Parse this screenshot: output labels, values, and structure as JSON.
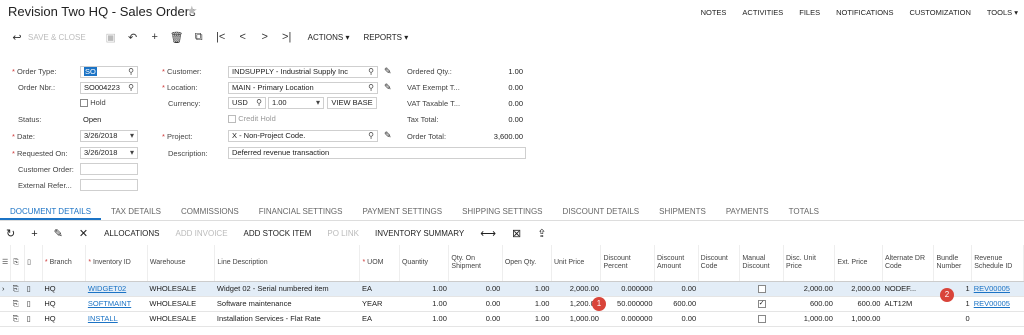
{
  "header": {
    "title": "Revision Two HQ  -  Sales Orders",
    "nav": [
      "NOTES",
      "ACTIVITIES",
      "FILES",
      "NOTIFICATIONS",
      "CUSTOMIZATION",
      "TOOLS ▾"
    ]
  },
  "toolbar": {
    "save_close": "SAVE & CLOSE",
    "actions": "ACTIONS ▾",
    "reports": "REPORTS ▾"
  },
  "form": {
    "order_type_label": "Order Type:",
    "order_type": "SO",
    "order_nbr_label": "Order Nbr.:",
    "order_nbr": "SO004223",
    "hold_label": "Hold",
    "status_label": "Status:",
    "status": "Open",
    "date_label": "Date:",
    "date": "3/26/2018",
    "requested_on_label": "Requested On:",
    "requested_on": "3/26/2018",
    "customer_order_label": "Customer Order:",
    "external_ref_label": "External Refer...",
    "customer_label": "Customer:",
    "customer": "INDSUPPLY - Industrial Supply Inc",
    "location_label": "Location:",
    "location": "MAIN - Primary Location",
    "currency_label": "Currency:",
    "currency": "USD",
    "rate": "1.00",
    "view_base": "VIEW BASE",
    "credit_hold_label": "Credit Hold",
    "project_label": "Project:",
    "project": "X - Non-Project Code.",
    "description_label": "Description:",
    "description": "Deferred revenue transaction",
    "ordered_qty_label": "Ordered Qty.:",
    "ordered_qty": "1.00",
    "vat_exempt_label": "VAT Exempt T...",
    "vat_exempt": "0.00",
    "vat_taxable_label": "VAT Taxable T...",
    "vat_taxable": "0.00",
    "tax_total_label": "Tax Total:",
    "tax_total": "0.00",
    "order_total_label": "Order Total:",
    "order_total": "3,600.00"
  },
  "tabs": [
    "DOCUMENT DETAILS",
    "TAX DETAILS",
    "COMMISSIONS",
    "FINANCIAL SETTINGS",
    "PAYMENT SETTINGS",
    "SHIPPING SETTINGS",
    "DISCOUNT DETAILS",
    "SHIPMENTS",
    "PAYMENTS",
    "TOTALS"
  ],
  "grid_toolbar": {
    "allocations": "ALLOCATIONS",
    "add_invoice": "ADD INVOICE",
    "add_stock_item": "ADD STOCK ITEM",
    "po_link": "PO LINK",
    "inventory_summary": "INVENTORY SUMMARY"
  },
  "columns": [
    "Branch",
    "Inventory ID",
    "Warehouse",
    "Line Description",
    "UOM",
    "Quantity",
    "Qty. On Shipment",
    "Open Qty.",
    "Unit Price",
    "Discount Percent",
    "Discount Amount",
    "Discount Code",
    "Manual Discount",
    "Disc. Unit Price",
    "Ext. Price",
    "Alternate DR Code",
    "Bundle Number",
    "Revenue Schedule ID"
  ],
  "rows": [
    {
      "branch": "HQ",
      "inventory_id": "WIDGET02",
      "warehouse": "WHOLESALE",
      "desc": "Widget 02 - Serial numbered item",
      "uom": "EA",
      "qty": "1.00",
      "qty_ship": "0.00",
      "open_qty": "1.00",
      "unit_price": "2,000.00",
      "disc_pct": "0.000000",
      "disc_amt": "0.00",
      "disc_code": "",
      "disc_unit": "2,000.00",
      "ext_price": "2,000.00",
      "alt_dr": "NODEF...",
      "bundle": "1",
      "rev_sched": "REV00005"
    },
    {
      "branch": "HQ",
      "inventory_id": "SOFTMAINT",
      "warehouse": "WHOLESALE",
      "desc": "Software maintenance",
      "uom": "YEAR",
      "qty": "1.00",
      "qty_ship": "0.00",
      "open_qty": "1.00",
      "unit_price": "1,200.00",
      "disc_pct": "50.000000",
      "disc_amt": "600.00",
      "disc_code": "",
      "disc_unit": "600.00",
      "ext_price": "600.00",
      "alt_dr": "ALT12M",
      "bundle": "1",
      "rev_sched": "REV00005"
    },
    {
      "branch": "HQ",
      "inventory_id": "INSTALL",
      "warehouse": "WHOLESALE",
      "desc": "Installation Services - Flat Rate",
      "uom": "EA",
      "qty": "1.00",
      "qty_ship": "0.00",
      "open_qty": "1.00",
      "unit_price": "1,000.00",
      "disc_pct": "0.000000",
      "disc_amt": "0.00",
      "disc_code": "",
      "disc_unit": "1,000.00",
      "ext_price": "1,000.00",
      "alt_dr": "",
      "bundle": "0",
      "rev_sched": ""
    }
  ],
  "badges": [
    "1",
    "2"
  ]
}
